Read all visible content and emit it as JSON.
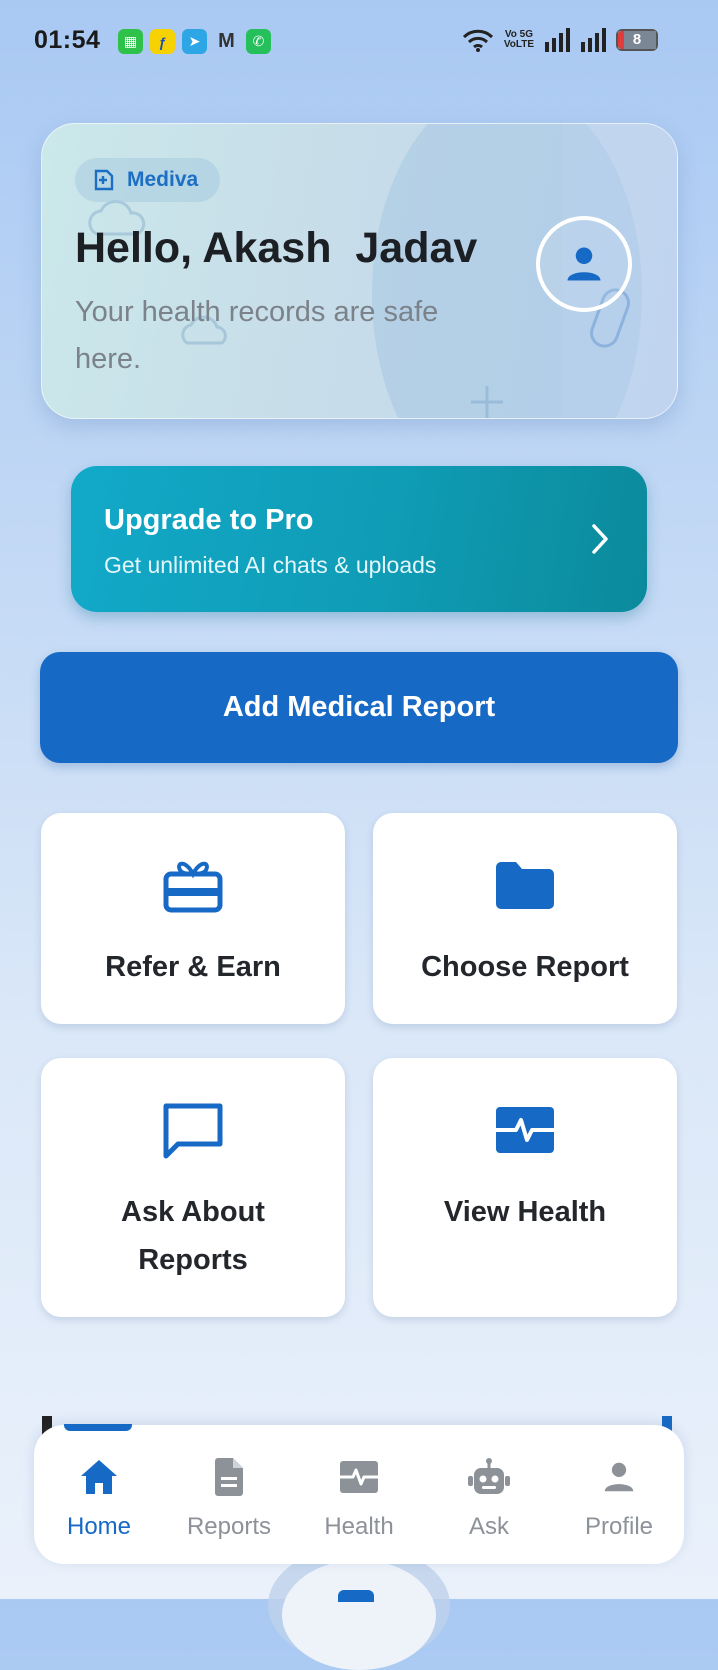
{
  "status_bar": {
    "time": "01:54",
    "network_top": "Vo 5G",
    "network_bottom": "VoLTE",
    "battery": "8"
  },
  "hero": {
    "brand": "Mediva",
    "greeting": "Hello, Akash  Jadav",
    "subtitle": "Your health records are safe here."
  },
  "upgrade": {
    "title": "Upgrade to Pro",
    "subtitle": "Get unlimited AI chats & uploads"
  },
  "primary_action": {
    "label": "Add Medical Report"
  },
  "tiles": [
    {
      "label": "Refer & Earn",
      "icon": "gift-icon"
    },
    {
      "label": "Choose Report",
      "icon": "folder-icon"
    },
    {
      "label": "Ask About Reports",
      "icon": "chat-icon"
    },
    {
      "label": "View Health",
      "icon": "heartbeat-icon"
    }
  ],
  "bottom_nav": {
    "items": [
      {
        "label": "Home",
        "icon": "home-icon",
        "active": true
      },
      {
        "label": "Reports",
        "icon": "document-icon",
        "active": false
      },
      {
        "label": "Health",
        "icon": "heartbeat-icon",
        "active": false
      },
      {
        "label": "Ask",
        "icon": "robot-icon",
        "active": false
      },
      {
        "label": "Profile",
        "icon": "person-icon",
        "active": false
      }
    ]
  },
  "colors": {
    "primary": "#1769c6",
    "teal": "#0f9cb5",
    "inactive": "#8d9299"
  }
}
